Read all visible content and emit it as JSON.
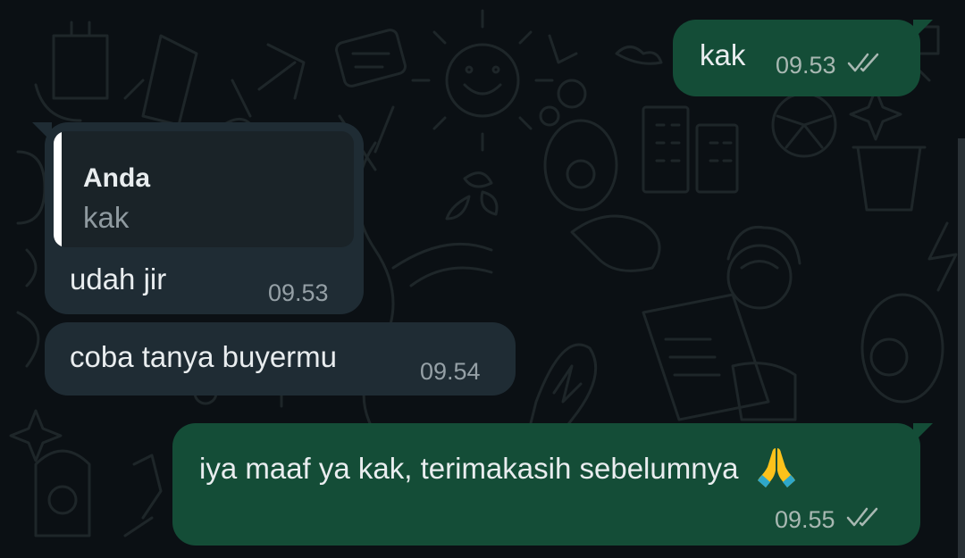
{
  "colors": {
    "background": "#0b1014",
    "outgoing_bubble": "#144d37",
    "incoming_bubble": "#1f2c34",
    "quote_bar": "#ffffff",
    "tick": "#a8b8b2"
  },
  "messages": [
    {
      "direction": "outgoing",
      "text": "kak",
      "time": "09.53",
      "status": "read-ticks-icon"
    },
    {
      "direction": "incoming",
      "reply_to": {
        "author": "Anda",
        "text": "kak"
      },
      "text": "udah jir",
      "time": "09.53"
    },
    {
      "direction": "incoming",
      "text": "coba tanya buyermu",
      "time": "09.54"
    },
    {
      "direction": "outgoing",
      "text": "iya maaf ya kak, terimakasih sebelumnya",
      "emoji": "folded-hands-icon",
      "time": "09.55",
      "status": "read-ticks-icon"
    }
  ]
}
